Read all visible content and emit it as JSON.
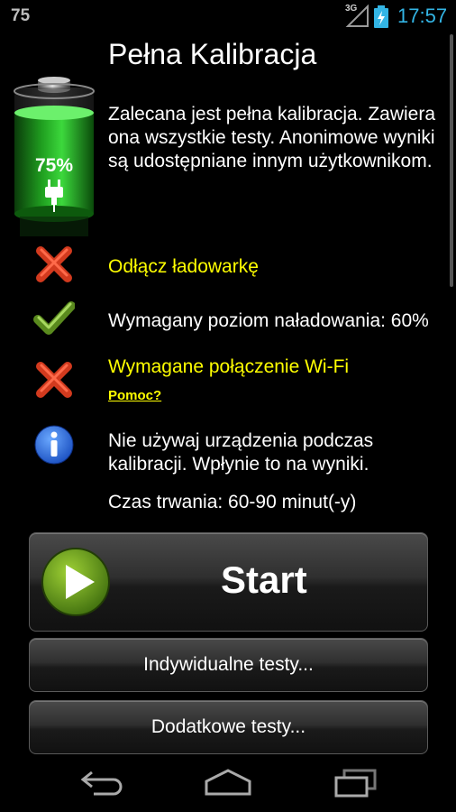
{
  "status_bar": {
    "notification": "75",
    "network": "3G",
    "time": "17:57"
  },
  "screen": {
    "title": "Pełna Kalibracja",
    "battery_percent": "75%",
    "battery_level": 0.75,
    "description": "Zalecana jest pełna kalibracja. Zawiera ona wszystkie testy. Anonimowe wyniki są udostępniane innym użytkownikom."
  },
  "requirements": [
    {
      "text": "Odłącz ładowarkę",
      "status": "fail",
      "icon": "cross-icon"
    },
    {
      "text": "Wymagany poziom naładowania: 60%",
      "status": "ok",
      "icon": "check-icon"
    },
    {
      "text": "Wymagane połączenie Wi-Fi",
      "status": "fail",
      "icon": "cross-icon"
    }
  ],
  "help_link": "Pomoc?",
  "info": {
    "icon": "info-icon",
    "text": "Nie używaj urządzenia podczas kalibracji. Wpłynie to na wyniki."
  },
  "duration": "Czas trwania: 60-90 minut(-y)",
  "buttons": {
    "start": "Start",
    "individual": "Indywidualne testy...",
    "additional": "Dodatkowe testy..."
  },
  "colors": {
    "accent": "#33b5e5",
    "warning": "#ffff00",
    "battery_green": "#22cc22"
  }
}
